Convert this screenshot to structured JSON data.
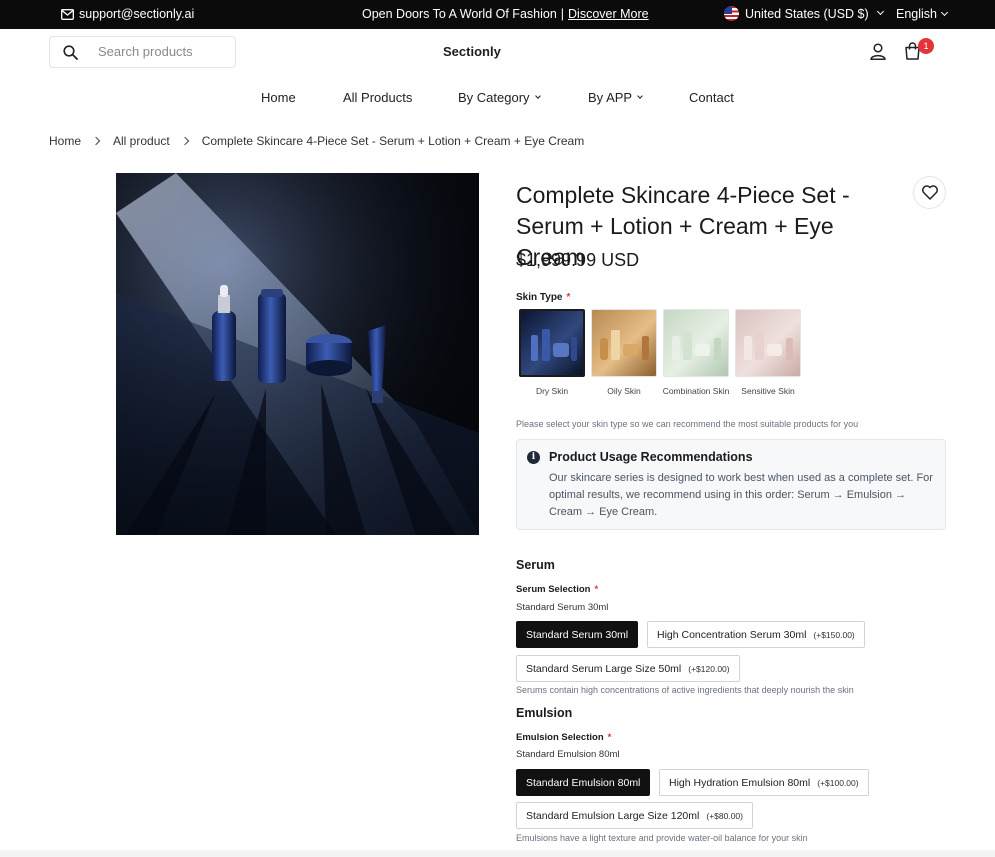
{
  "topbar": {
    "email": "support@sectionly.ai",
    "promo_text": "Open Doors To A World Of Fashion",
    "promo_sep": "|",
    "promo_link": "Discover More",
    "region": "United States (USD $)",
    "language": "English"
  },
  "header": {
    "search_placeholder": "Search products",
    "logo": "Sectionly",
    "cart_count": "1"
  },
  "nav": {
    "items": [
      "Home",
      "All Products",
      "By Category",
      "By APP",
      "Contact"
    ]
  },
  "breadcrumb": {
    "items": [
      "Home",
      "All product",
      "Complete Skincare 4-Piece Set - Serum + Lotion + Cream + Eye Cream"
    ]
  },
  "product": {
    "title": "Complete Skincare 4-Piece Set - Serum + Lotion + Cream + Eye Cream",
    "price": "$1,999.99 USD"
  },
  "skin_type": {
    "label": "Skin Type",
    "required": "*",
    "options": [
      "Dry Skin",
      "Oily Skin",
      "Combination Skin",
      "Sensitive Skin"
    ],
    "selected": "Dry Skin",
    "hint": "Please select your skin type so we can recommend the most suitable products for you"
  },
  "usage": {
    "heading": "Product Usage Recommendations",
    "body": "Our skincare series is designed to work best when used as a complete set. For optimal results, we recommend using in this order: Serum → Emulsion → Cream → Eye Cream."
  },
  "serum": {
    "heading": "Serum",
    "selection_label": "Serum Selection",
    "required": "*",
    "current": "Standard Serum 30ml",
    "options": [
      {
        "label": "Standard Serum 30ml",
        "extra": ""
      },
      {
        "label": "High Concentration Serum 30ml",
        "extra": "(+$150.00)"
      },
      {
        "label": "Standard Serum Large Size 50ml",
        "extra": "(+$120.00)"
      }
    ],
    "note": "Serums contain high concentrations of active ingredients that deeply nourish the skin"
  },
  "emulsion": {
    "heading": "Emulsion",
    "selection_label": "Emulsion Selection",
    "required": "*",
    "current": "Standard Emulsion 80ml",
    "options": [
      {
        "label": "Standard Emulsion 80ml",
        "extra": ""
      },
      {
        "label": "High Hydration Emulsion 80ml",
        "extra": "(+$100.00)"
      },
      {
        "label": "Standard Emulsion Large Size 120ml",
        "extra": "(+$80.00)"
      }
    ],
    "note": "Emulsions have a light texture and provide water-oil balance for your skin"
  }
}
